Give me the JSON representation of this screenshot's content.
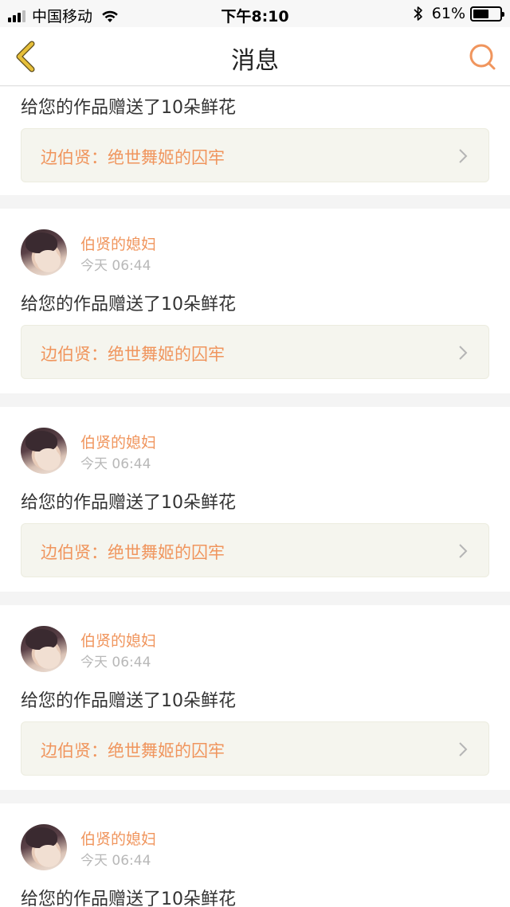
{
  "status_bar": {
    "carrier": "中国移动",
    "time": "下午8:10",
    "battery_percent": "61%",
    "battery_level": 0.61,
    "icons": [
      "signal-icon",
      "wifi-icon",
      "bluetooth-icon",
      "battery-icon"
    ]
  },
  "nav": {
    "title": "消息",
    "back_icon": "chevron-left-icon",
    "search_icon": "search-icon"
  },
  "colors": {
    "accent": "#f0955d",
    "back_icon": "#e6bf3a",
    "link_background": "#f5f5ee",
    "separator": "#f4f4f4"
  },
  "messages": [
    {
      "message": "给您的作品赠送了10朵鲜花",
      "work": "边伯贤：绝世舞姬的囚牢"
    },
    {
      "user": "伯贤的媳妇",
      "time": "今天 06:44",
      "message": "给您的作品赠送了10朵鲜花",
      "work": "边伯贤：绝世舞姬的囚牢"
    },
    {
      "user": "伯贤的媳妇",
      "time": "今天 06:44",
      "message": "给您的作品赠送了10朵鲜花",
      "work": "边伯贤：绝世舞姬的囚牢"
    },
    {
      "user": "伯贤的媳妇",
      "time": "今天 06:44",
      "message": "给您的作品赠送了10朵鲜花",
      "work": "边伯贤：绝世舞姬的囚牢"
    },
    {
      "user": "伯贤的媳妇",
      "time": "今天 06:44",
      "message": "给您的作品赠送了10朵鲜花"
    }
  ]
}
